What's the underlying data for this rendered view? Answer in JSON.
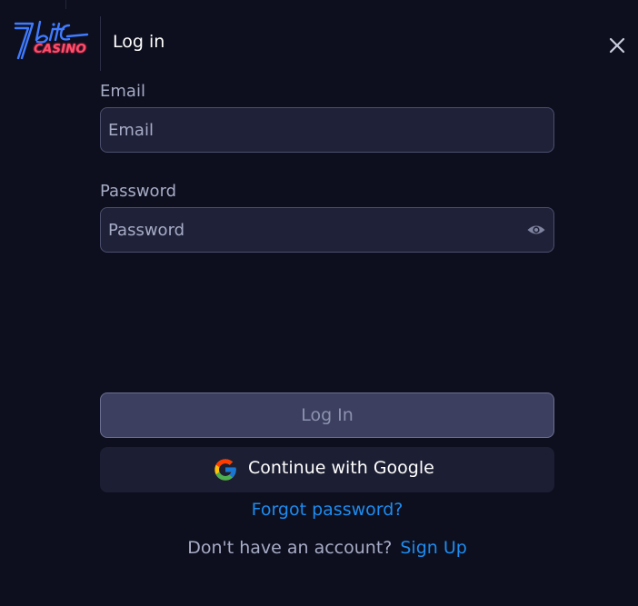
{
  "brand": {
    "logo_text": "CASINO"
  },
  "header": {
    "title": "Log in"
  },
  "icons": {
    "close": "close-icon",
    "eye": "eye-icon",
    "google": "google-icon"
  },
  "form": {
    "email": {
      "label": "Email",
      "placeholder": "Email",
      "value": ""
    },
    "password": {
      "label": "Password",
      "placeholder": "Password",
      "value": ""
    }
  },
  "actions": {
    "login_label": "Log In",
    "google_label": "Continue with Google",
    "forgot_label": "Forgot password?",
    "signup_prompt": "Don't have an account?",
    "signup_label": "Sign Up"
  },
  "colors": {
    "background": "#0d0f1e",
    "input_bg": "#1f2138",
    "link": "#1d8cf0",
    "logo_neon_blue": "#3f7bff",
    "logo_neon_red": "#ff4d6a"
  }
}
